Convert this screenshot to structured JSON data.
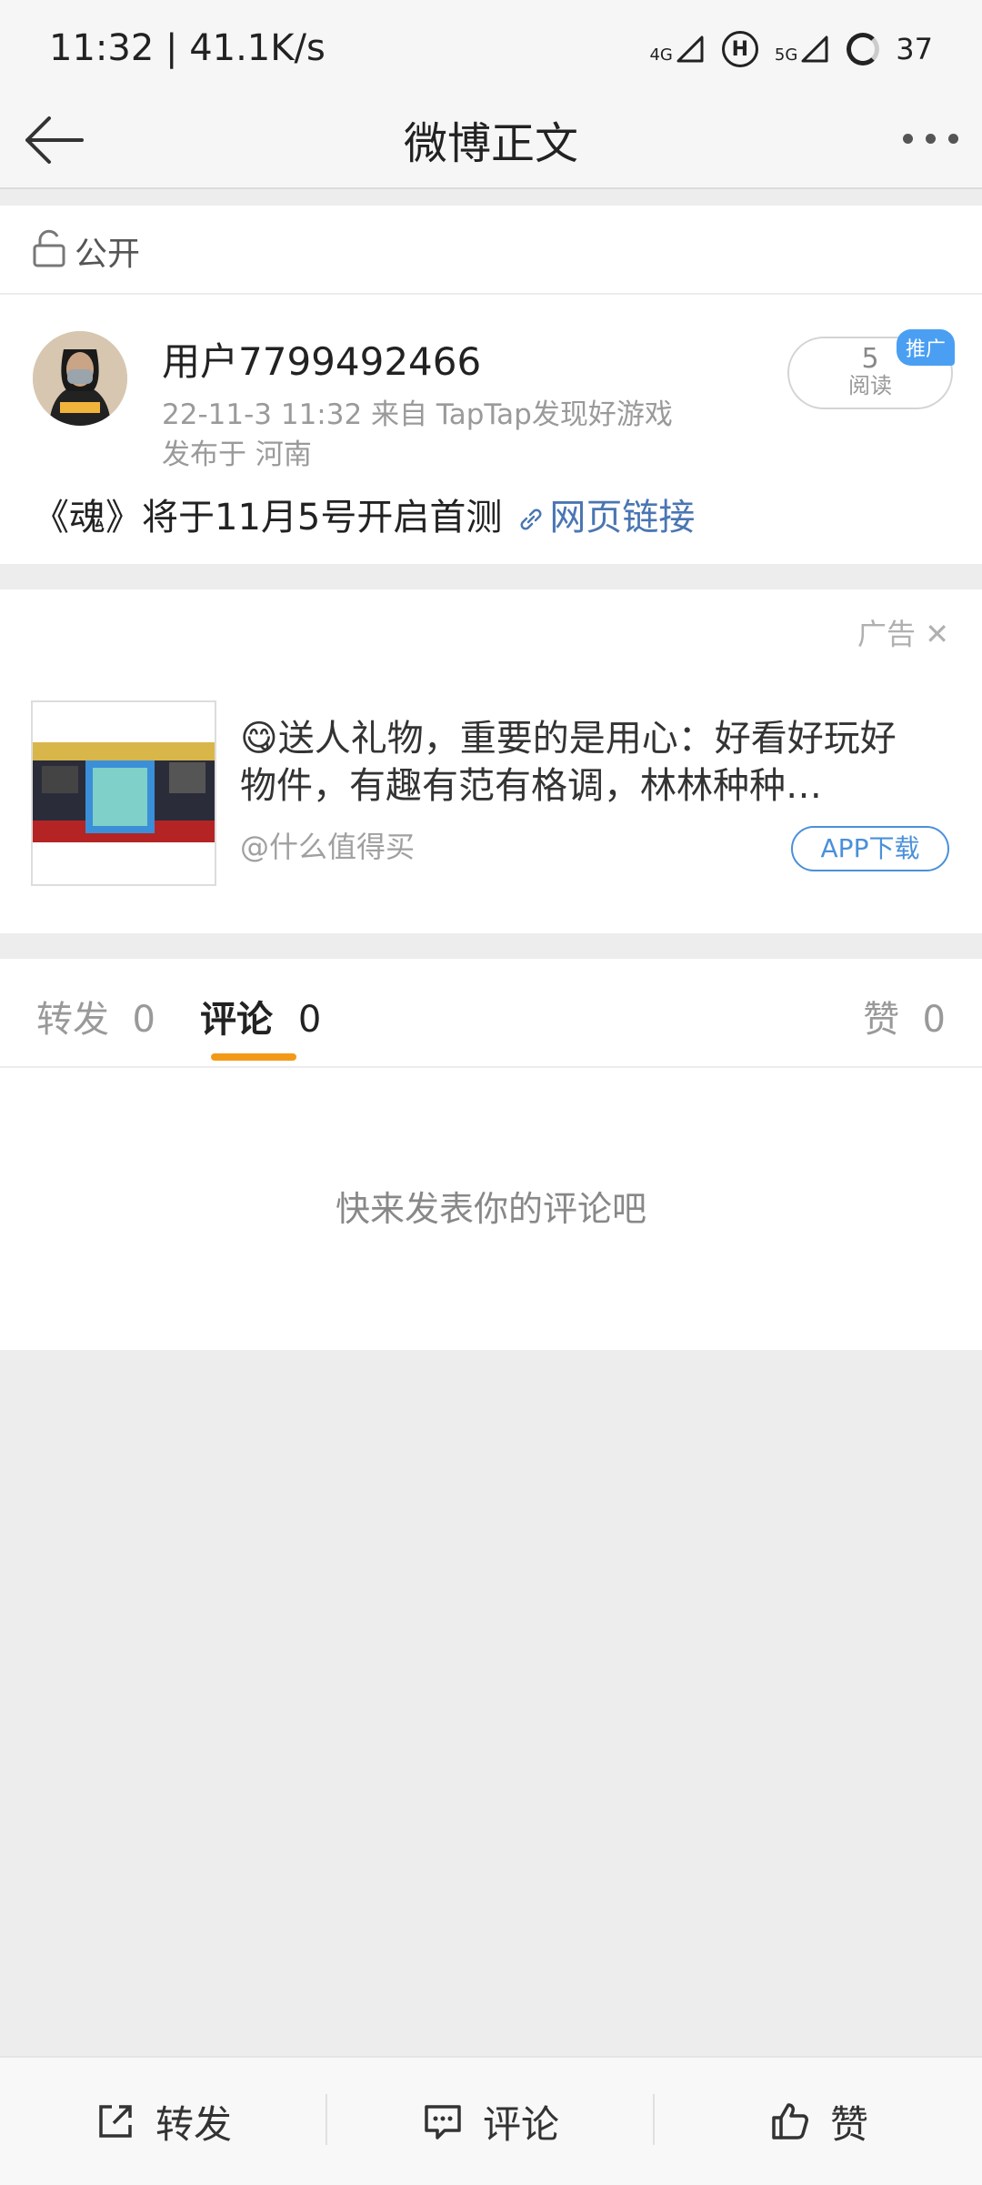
{
  "status": {
    "time": "11:32",
    "speed": "41.1K/s",
    "sig1": "4G",
    "h": "H",
    "sig2": "5G",
    "battery": "37"
  },
  "nav": {
    "title": "微博正文"
  },
  "visibility": {
    "label": "公开"
  },
  "post": {
    "username": "用户7799492466",
    "meta": "22-11-3 11:32   来自 TapTap发现好游戏",
    "location": "发布于 河南",
    "read_count": "5",
    "read_label": "阅读",
    "promo_badge": "推广",
    "text": "《魂》将于11月5号开启首测",
    "link_text": "网页链接"
  },
  "ad": {
    "label": "广告",
    "title": "😋送人礼物，重要的是用心：好看好玩好物件，有趣有范有格调，林林种种…",
    "source": "@什么值得买",
    "button": "APP下载"
  },
  "tabs": {
    "repost_label": "转发",
    "repost_count": "0",
    "comment_label": "评论",
    "comment_count": "0",
    "like_label": "赞",
    "like_count": "0"
  },
  "empty_text": "快来发表你的评论吧",
  "bottom": {
    "repost": "转发",
    "comment": "评论",
    "like": "赞"
  },
  "colors": {
    "accent": "#f29a17",
    "link": "#4a76b2",
    "badge": "#4a9ff3"
  }
}
